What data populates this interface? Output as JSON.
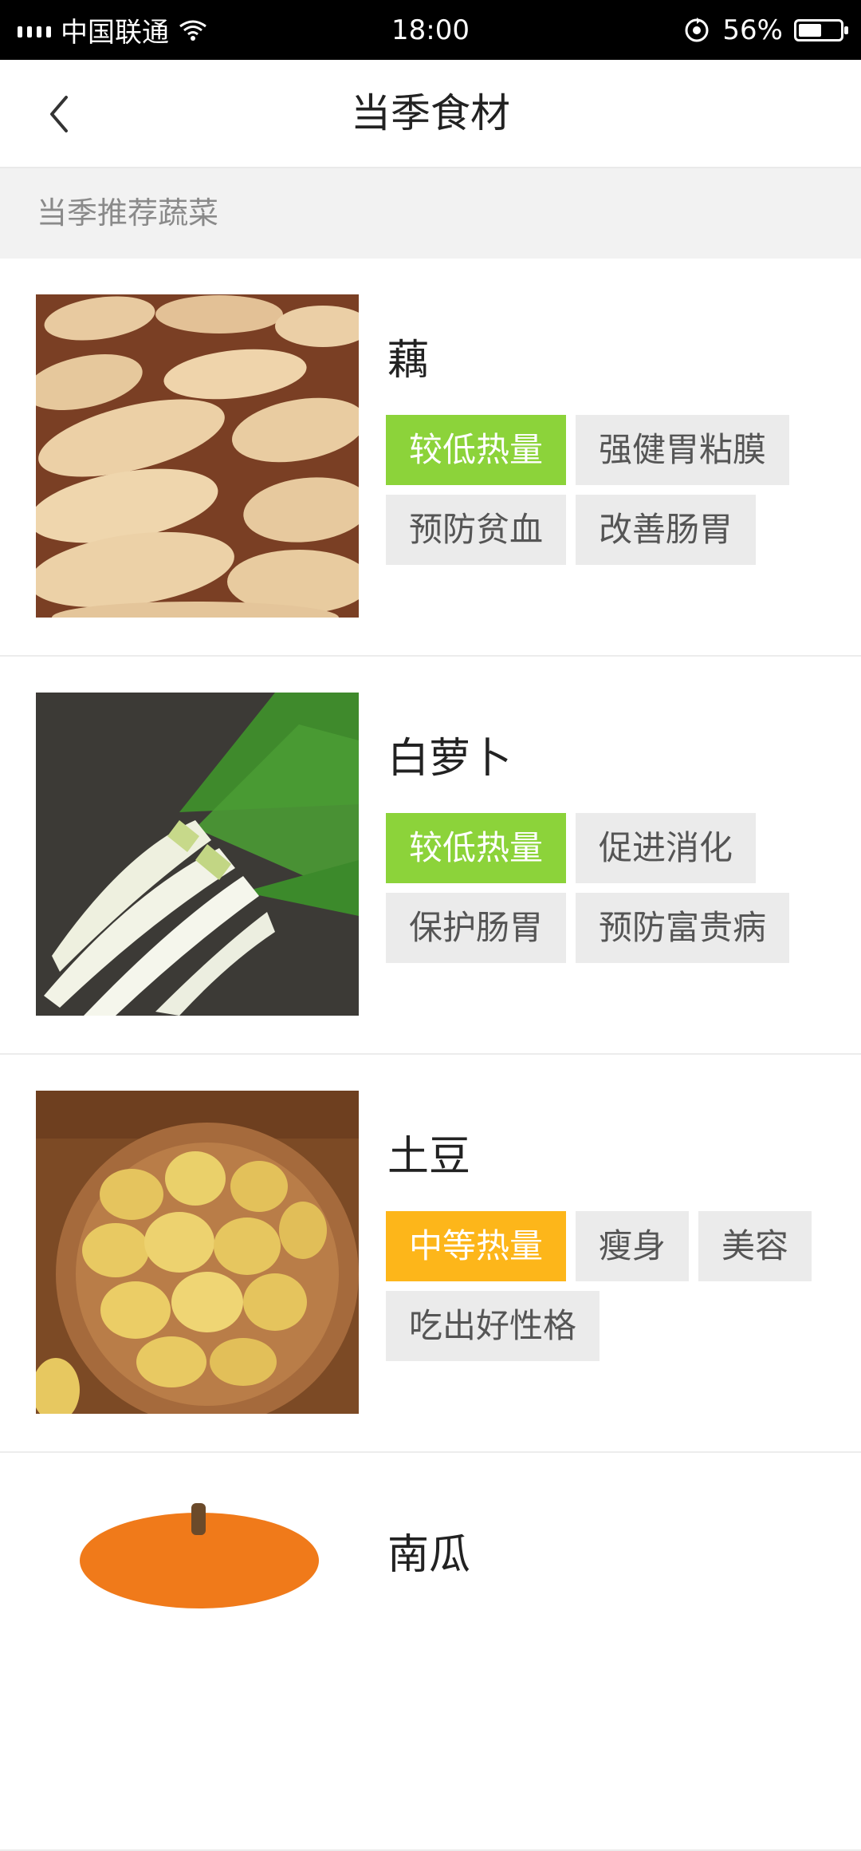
{
  "status": {
    "carrier": "中国联通",
    "time": "18:00",
    "battery_text": "56%",
    "battery_level": 0.56,
    "icons": [
      "signal-icon",
      "wifi-icon",
      "rotation-lock-icon",
      "battery-icon"
    ]
  },
  "nav": {
    "title": "当季食材",
    "back_icon": "chevron-left-icon"
  },
  "section": {
    "title": "当季推荐蔬菜"
  },
  "colors": {
    "low_calorie": "#8cd33a",
    "medium_calorie": "#fdb61a",
    "tag_bg": "#ebebeb"
  },
  "items": [
    {
      "name": "藕",
      "tags": [
        "较低热量",
        "强健胃粘膜",
        "预防贫血",
        "改善肠胃"
      ],
      "calorie": "low"
    },
    {
      "name": "白萝卜",
      "tags": [
        "较低热量",
        "促进消化",
        "保护肠胃",
        "预防富贵病"
      ],
      "calorie": "low"
    },
    {
      "name": "土豆",
      "tags": [
        "中等热量",
        "瘦身",
        "美容",
        "吃出好性格"
      ],
      "calorie": "medium"
    },
    {
      "name": "南瓜",
      "tags": [],
      "calorie": ""
    }
  ]
}
